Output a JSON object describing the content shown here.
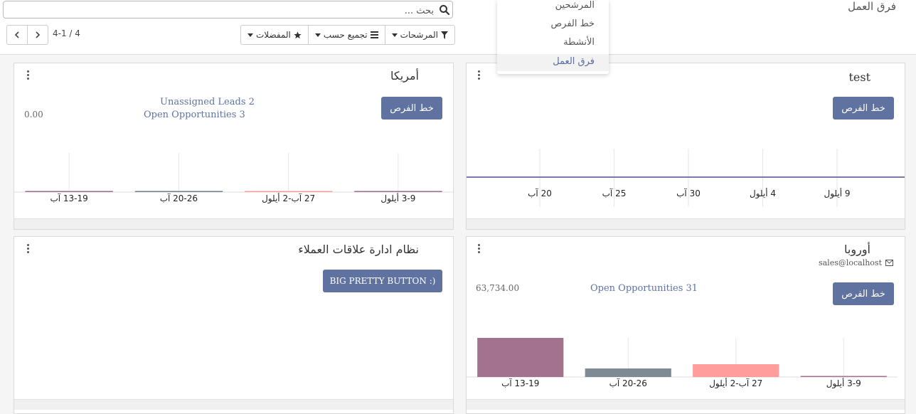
{
  "page_title": "فرق العمل",
  "search": {
    "placeholder": "بحث ..."
  },
  "toolbar": {
    "filters_label": "المرشحات",
    "group_by_label": "تجميع حسب",
    "favorites_label": "المفضلات"
  },
  "pager": {
    "value": "4-1 / 4"
  },
  "menu": {
    "items": [
      "المرشحين",
      "خط الفرص",
      "الأنشطة",
      "فرق العمل"
    ],
    "active": "فرق العمل"
  },
  "cards": {
    "america": {
      "title": "أمريكا",
      "button_label": "خط الفرص",
      "unassigned_leads": "Unassigned Leads 2",
      "open_opportunities": "Open Opportunities 3",
      "amount": "0.00"
    },
    "test": {
      "title": "test",
      "button_label": "خط الفرص"
    },
    "crm": {
      "title": "نظام ادارة علاقات العملاء",
      "button_label": "BIG PRETTY BUTTON :)"
    },
    "europe": {
      "title": "أوروبا",
      "email": "sales@localhost",
      "button_label": "خط الفرص",
      "open_opportunities": "Open Opportunities 31",
      "amount": "63,734.00"
    }
  },
  "chart_data": [
    {
      "type": "bar",
      "panel": "america",
      "categories": [
        "13-19 آب",
        "20-26 آب",
        "27 آب-2 أيلول",
        "3-9 أيلول"
      ],
      "values": [
        0.1,
        0.1,
        0.1,
        0.1
      ],
      "colors": [
        "#9b6b8e",
        "#6d7f8a",
        "#ff9c9c",
        "#9b6b8e"
      ]
    },
    {
      "type": "line",
      "panel": "test",
      "categories": [
        "20 آب",
        "25 آب",
        "30 آب",
        "4 أيلول",
        "9 أيلول"
      ],
      "values": [
        0,
        0,
        0,
        0,
        0
      ],
      "color": "#7a78a8"
    },
    {
      "type": "bar",
      "panel": "europe",
      "categories": [
        "13-19 آب",
        "20-26 آب",
        "27 آب-2 أيلول",
        "3-9 أيلول"
      ],
      "values": [
        55,
        12,
        18,
        1
      ],
      "colors": [
        "#a3728f",
        "#7e8b94",
        "#ff9c9c",
        "#a3728f"
      ]
    }
  ]
}
